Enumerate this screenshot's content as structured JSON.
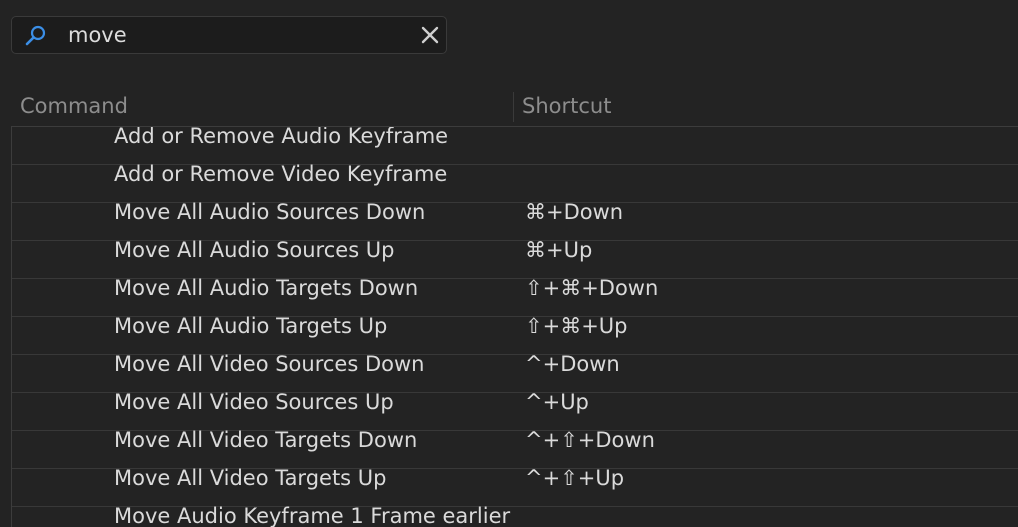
{
  "search": {
    "value": "move",
    "placeholder": ""
  },
  "icons": {
    "search": "search-icon",
    "clear": "close-icon"
  },
  "table": {
    "headers": {
      "command": "Command",
      "shortcut": "Shortcut"
    },
    "rows": [
      {
        "command": "Add or Remove Audio Keyframe",
        "shortcut": ""
      },
      {
        "command": "Add or Remove Video Keyframe",
        "shortcut": ""
      },
      {
        "command": "Move All Audio Sources Down",
        "shortcut": "⌘+Down"
      },
      {
        "command": "Move All Audio Sources Up",
        "shortcut": "⌘+Up"
      },
      {
        "command": "Move All Audio Targets Down",
        "shortcut": "⇧+⌘+Down"
      },
      {
        "command": "Move All Audio Targets Up",
        "shortcut": "⇧+⌘+Up"
      },
      {
        "command": "Move All Video Sources Down",
        "shortcut": "^+Down"
      },
      {
        "command": "Move All Video Sources Up",
        "shortcut": "^+Up"
      },
      {
        "command": "Move All Video Targets Down",
        "shortcut": "^+⇧+Down"
      },
      {
        "command": "Move All Video Targets Up",
        "shortcut": "^+⇧+Up"
      },
      {
        "command": "Move Audio Keyframe 1 Frame earlier",
        "shortcut": ""
      }
    ]
  },
  "colors": {
    "background": "#232323",
    "search_icon": "#3b8ee6"
  }
}
